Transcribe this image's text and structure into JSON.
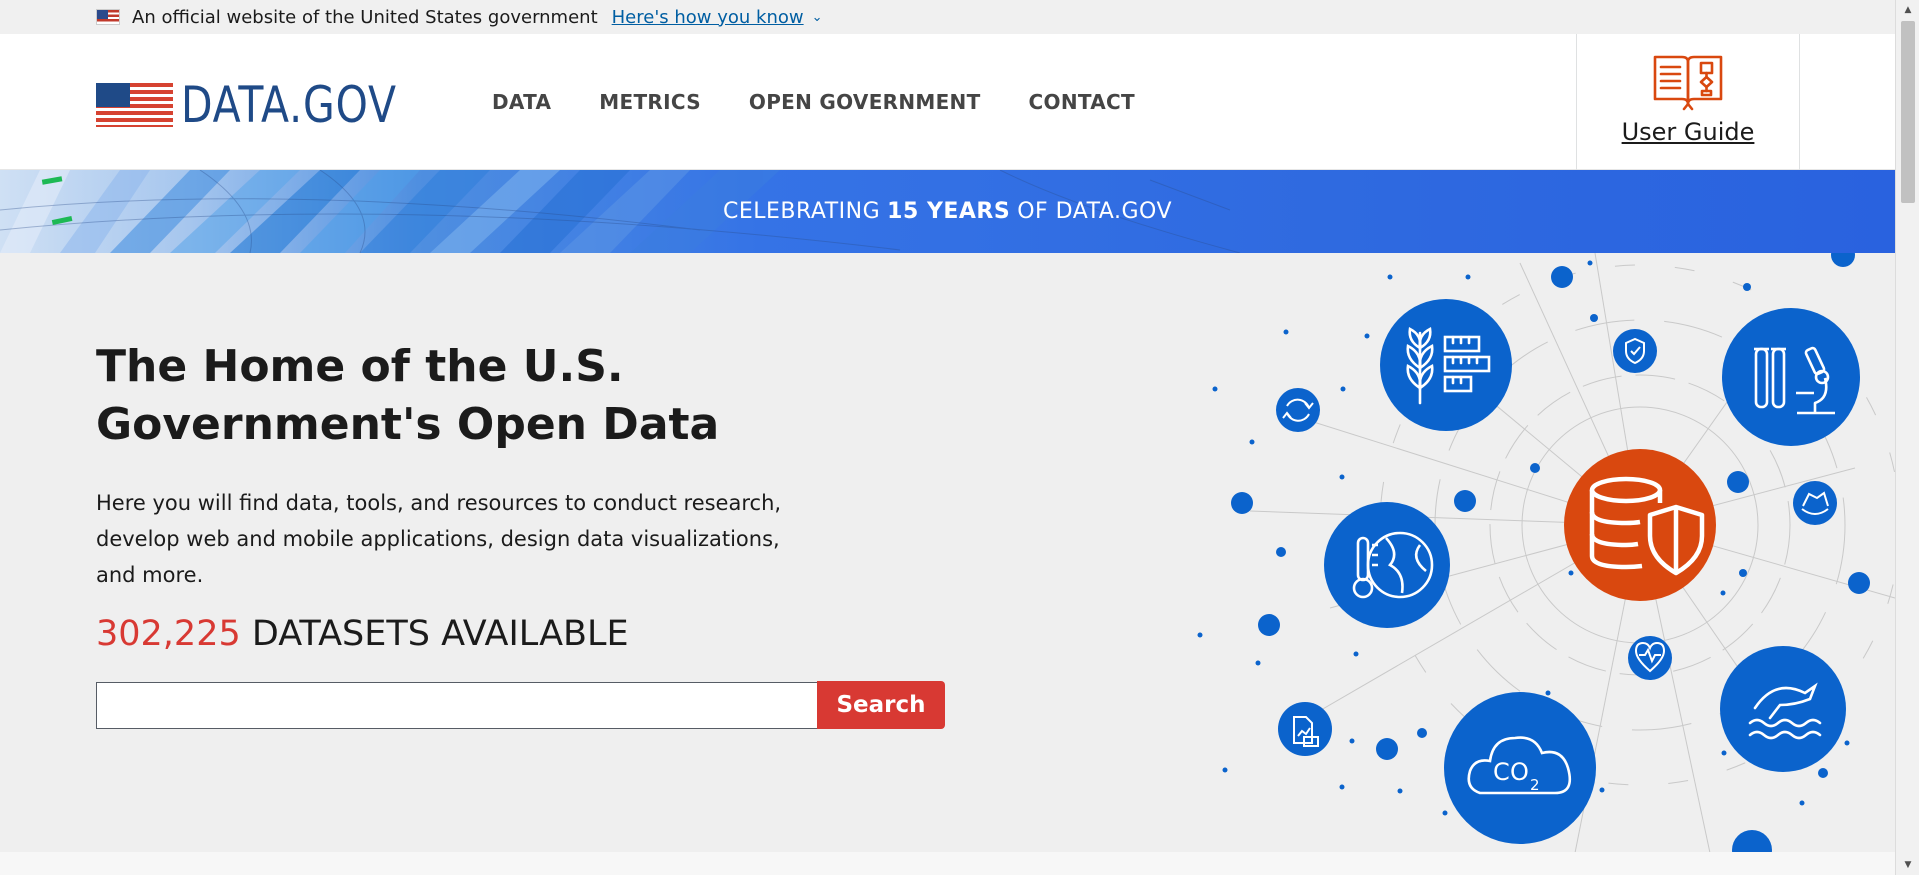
{
  "gov_banner": {
    "text": "An official website of the United States government",
    "link": "Here's how you know"
  },
  "header": {
    "logo_text": "DATA.GOV",
    "nav": [
      "DATA",
      "METRICS",
      "OPEN GOVERNMENT",
      "CONTACT"
    ],
    "user_guide": "User Guide"
  },
  "celebrate": {
    "prefix": "CELEBRATING",
    "bold": "15 YEARS",
    "suffix": "OF DATA.GOV"
  },
  "hero": {
    "title": "The Home of the U.S. Government's Open Data",
    "description": "Here you will find data, tools, and resources to conduct research, develop web and mobile applications, design data visualizations, and more.",
    "dataset_count": "302,225",
    "dataset_label": "DATASETS AVAILABLE",
    "search_placeholder": "",
    "search_button": "Search"
  },
  "colors": {
    "brand_blue": "#1f4a87",
    "accent_red": "#d83933",
    "illustration_blue": "#0b63cc",
    "illustration_orange": "#d9480f"
  }
}
